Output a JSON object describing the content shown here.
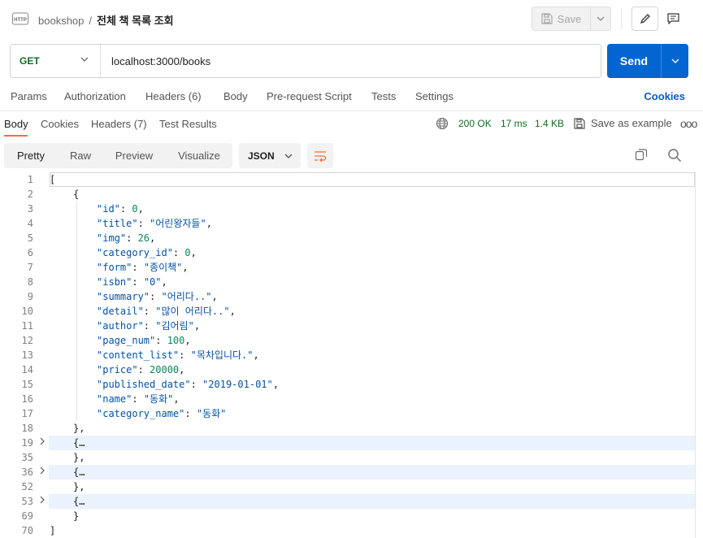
{
  "header": {
    "icon_label": "HTTP",
    "collection": "bookshop",
    "separator": "/",
    "request_name": "전체 책 목록 조회",
    "save_label": "Save"
  },
  "request": {
    "method": "GET",
    "url": "localhost:3000/books",
    "send_label": "Send"
  },
  "request_tabs": [
    "Params",
    "Authorization",
    "Headers (6)",
    "Body",
    "Pre-request Script",
    "Tests",
    "Settings"
  ],
  "cookies_label": "Cookies",
  "response_tabs": [
    "Body",
    "Cookies",
    "Headers (7)",
    "Test Results"
  ],
  "response_meta": {
    "status": "200 OK",
    "time": "17 ms",
    "size": "1.4 KB",
    "save_example": "Save as example",
    "more": "ooo"
  },
  "view_tabs": [
    "Pretty",
    "Raw",
    "Preview",
    "Visualize"
  ],
  "format": "JSON",
  "code_lines": [
    {
      "n": "1",
      "indent": 0,
      "tokens": [
        [
          "p",
          "["
        ]
      ]
    },
    {
      "n": "2",
      "indent": 1,
      "tokens": [
        [
          "p",
          "{"
        ]
      ]
    },
    {
      "n": "3",
      "indent": 2,
      "tokens": [
        [
          "k",
          "\"id\""
        ],
        [
          "p",
          ": "
        ],
        [
          "n",
          "0"
        ],
        [
          "p",
          ","
        ]
      ]
    },
    {
      "n": "4",
      "indent": 2,
      "tokens": [
        [
          "k",
          "\"title\""
        ],
        [
          "p",
          ": "
        ],
        [
          "s",
          "\"어린왕자들\""
        ],
        [
          "p",
          ","
        ]
      ]
    },
    {
      "n": "5",
      "indent": 2,
      "tokens": [
        [
          "k",
          "\"img\""
        ],
        [
          "p",
          ": "
        ],
        [
          "n",
          "26"
        ],
        [
          "p",
          ","
        ]
      ]
    },
    {
      "n": "6",
      "indent": 2,
      "tokens": [
        [
          "k",
          "\"category_id\""
        ],
        [
          "p",
          ": "
        ],
        [
          "n",
          "0"
        ],
        [
          "p",
          ","
        ]
      ]
    },
    {
      "n": "7",
      "indent": 2,
      "tokens": [
        [
          "k",
          "\"form\""
        ],
        [
          "p",
          ": "
        ],
        [
          "s",
          "\"종이책\""
        ],
        [
          "p",
          ","
        ]
      ]
    },
    {
      "n": "8",
      "indent": 2,
      "tokens": [
        [
          "k",
          "\"isbn\""
        ],
        [
          "p",
          ": "
        ],
        [
          "s",
          "\"0\""
        ],
        [
          "p",
          ","
        ]
      ]
    },
    {
      "n": "9",
      "indent": 2,
      "tokens": [
        [
          "k",
          "\"summary\""
        ],
        [
          "p",
          ": "
        ],
        [
          "s",
          "\"어리다..\""
        ],
        [
          "p",
          ","
        ]
      ]
    },
    {
      "n": "10",
      "indent": 2,
      "tokens": [
        [
          "k",
          "\"detail\""
        ],
        [
          "p",
          ": "
        ],
        [
          "s",
          "\"많이 어리다..\""
        ],
        [
          "p",
          ","
        ]
      ]
    },
    {
      "n": "11",
      "indent": 2,
      "tokens": [
        [
          "k",
          "\"author\""
        ],
        [
          "p",
          ": "
        ],
        [
          "s",
          "\"김어림\""
        ],
        [
          "p",
          ","
        ]
      ]
    },
    {
      "n": "12",
      "indent": 2,
      "tokens": [
        [
          "k",
          "\"page_num\""
        ],
        [
          "p",
          ": "
        ],
        [
          "n",
          "100"
        ],
        [
          "p",
          ","
        ]
      ]
    },
    {
      "n": "13",
      "indent": 2,
      "tokens": [
        [
          "k",
          "\"content_list\""
        ],
        [
          "p",
          ": "
        ],
        [
          "s",
          "\"목차입니다.\""
        ],
        [
          "p",
          ","
        ]
      ]
    },
    {
      "n": "14",
      "indent": 2,
      "tokens": [
        [
          "k",
          "\"price\""
        ],
        [
          "p",
          ": "
        ],
        [
          "n",
          "20000"
        ],
        [
          "p",
          ","
        ]
      ]
    },
    {
      "n": "15",
      "indent": 2,
      "tokens": [
        [
          "k",
          "\"published_date\""
        ],
        [
          "p",
          ": "
        ],
        [
          "s",
          "\"2019-01-01\""
        ],
        [
          "p",
          ","
        ]
      ]
    },
    {
      "n": "16",
      "indent": 2,
      "tokens": [
        [
          "k",
          "\"name\""
        ],
        [
          "p",
          ": "
        ],
        [
          "s",
          "\"동화\""
        ],
        [
          "p",
          ","
        ]
      ]
    },
    {
      "n": "17",
      "indent": 2,
      "tokens": [
        [
          "k",
          "\"category_name\""
        ],
        [
          "p",
          ": "
        ],
        [
          "s",
          "\"동화\""
        ]
      ]
    },
    {
      "n": "18",
      "indent": 1,
      "tokens": [
        [
          "p",
          "},"
        ]
      ]
    },
    {
      "n": "19",
      "indent": 1,
      "fold": true,
      "tokens": [
        [
          "p",
          "{…"
        ]
      ]
    },
    {
      "n": "35",
      "indent": 1,
      "tokens": [
        [
          "p",
          "},"
        ]
      ]
    },
    {
      "n": "36",
      "indent": 1,
      "fold": true,
      "tokens": [
        [
          "p",
          "{…"
        ]
      ]
    },
    {
      "n": "52",
      "indent": 1,
      "tokens": [
        [
          "p",
          "},"
        ]
      ]
    },
    {
      "n": "53",
      "indent": 1,
      "fold": true,
      "tokens": [
        [
          "p",
          "{…"
        ]
      ]
    },
    {
      "n": "69",
      "indent": 1,
      "tokens": [
        [
          "p",
          "}"
        ]
      ]
    },
    {
      "n": "70",
      "indent": 0,
      "tokens": [
        [
          "p",
          "]"
        ]
      ]
    }
  ],
  "colors": {
    "accent": "#ff6c37",
    "send": "#0265d2",
    "method": "#146b24",
    "status": "#146b24",
    "fold_highlight": "#eaf2fd"
  }
}
